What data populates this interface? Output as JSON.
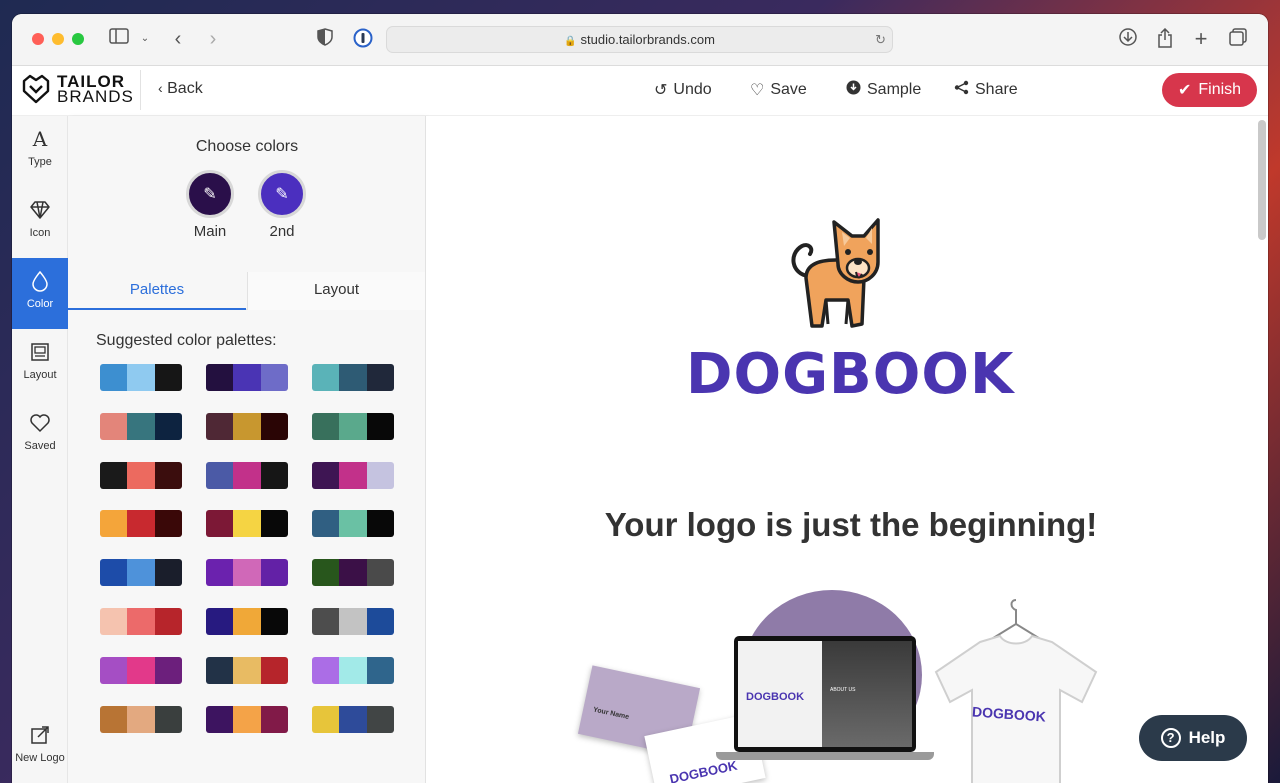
{
  "browser": {
    "url": "studio.tailorbrands.com"
  },
  "header": {
    "brand_line1": "TAILOR",
    "brand_line2": "BRANDS",
    "back_label": "Back",
    "undo_label": "Undo",
    "save_label": "Save",
    "sample_label": "Sample",
    "share_label": "Share",
    "finish_label": "Finish"
  },
  "rail": {
    "items": [
      {
        "label": "Type",
        "icon": "type-icon"
      },
      {
        "label": "Icon",
        "icon": "diamond-icon"
      },
      {
        "label": "Color",
        "icon": "drop-icon",
        "active": true
      },
      {
        "label": "Layout",
        "icon": "layout-icon"
      },
      {
        "label": "Saved",
        "icon": "heart-icon"
      }
    ],
    "new_logo_label": "New Logo"
  },
  "panel": {
    "title": "Choose colors",
    "main_label": "Main",
    "second_label": "2nd",
    "main_color": "#2a0f4a",
    "second_color": "#4b2fbf",
    "tabs": [
      "Palettes",
      "Layout"
    ],
    "suggested_label": "Suggested color palettes:",
    "palettes": [
      [
        "#3d8fd0",
        "#8fcaf0",
        "#161616"
      ],
      [
        "#23103f",
        "#4a34b4",
        "#6e6cc8"
      ],
      [
        "#5ab3b8",
        "#2e5b74",
        "#20283a"
      ],
      [
        "#e3857a",
        "#37757e",
        "#0d2340"
      ],
      [
        "#4f2835",
        "#c8972f",
        "#2a0505"
      ],
      [
        "#38705c",
        "#5aa98c",
        "#080808"
      ],
      [
        "#1a1a1a",
        "#ec6a5f",
        "#3b0d0d"
      ],
      [
        "#4b5aa6",
        "#c2318a",
        "#161616"
      ],
      [
        "#3e1553",
        "#c2318a",
        "#c5c3e0"
      ],
      [
        "#f4a53a",
        "#c8292f",
        "#3a0808"
      ],
      [
        "#7c1836",
        "#f5d443",
        "#080808"
      ],
      [
        "#305f82",
        "#6ac1a4",
        "#080808"
      ],
      [
        "#1d4ca9",
        "#4e92da",
        "#1a1e2b"
      ],
      [
        "#6b22ae",
        "#d068b8",
        "#6321a6"
      ],
      [
        "#28561c",
        "#3b1047",
        "#4a4a4a"
      ],
      [
        "#f5c3af",
        "#ec6a6a",
        "#b7252b"
      ],
      [
        "#271a80",
        "#f0a838",
        "#080808"
      ],
      [
        "#4d4d4d",
        "#c3c3c3",
        "#1d4b9a"
      ],
      [
        "#a54ec4",
        "#e2398a",
        "#6c1f7c"
      ],
      [
        "#223247",
        "#e8bb63",
        "#b6252b"
      ],
      [
        "#ab6de6",
        "#a2eae8",
        "#2f658c"
      ],
      [
        "#b87434",
        "#e3a980",
        "#3a3f3e"
      ],
      [
        "#3d1460",
        "#f4a348",
        "#811a48"
      ],
      [
        "#e7c53a",
        "#2e4b9a",
        "#414545"
      ]
    ]
  },
  "canvas": {
    "logo_name": "DOGBOOK",
    "tagline": "Your logo is just the beginning!",
    "business_card_name": "Your Name",
    "mockup_about": "ABOUT US"
  },
  "help_label": "Help"
}
